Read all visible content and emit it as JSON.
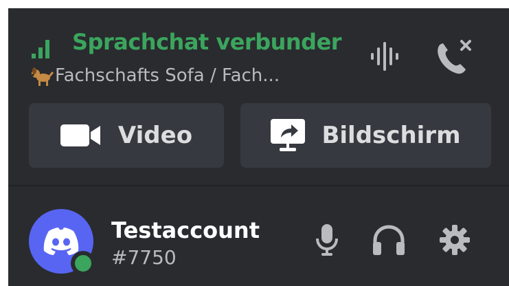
{
  "voice": {
    "status_title": "Sprachchat verbunder",
    "channel": "Fachschafts Sofa / Fach...",
    "icons": {
      "signal": "signal-bars-icon",
      "noise": "noise-suppression-icon",
      "disconnect": "disconnect-call-icon",
      "channel_emoji": "dog-emoji-icon"
    }
  },
  "actions": {
    "video_label": "Video",
    "screen_label": "Bildschirm",
    "icons": {
      "video": "video-camera-icon",
      "screen": "screen-share-icon"
    }
  },
  "user": {
    "name": "Testaccount",
    "discriminator": "#7750",
    "status": "online",
    "icons": {
      "avatar": "discord-logo-icon",
      "mic": "microphone-icon",
      "headset": "headphones-icon",
      "settings": "gear-icon"
    }
  },
  "colors": {
    "panel_bg": "#292b2f",
    "button_bg": "#36393f",
    "connected_green": "#3ba55d",
    "blurple": "#5865f2",
    "icon_gray": "#b9bbbe"
  }
}
